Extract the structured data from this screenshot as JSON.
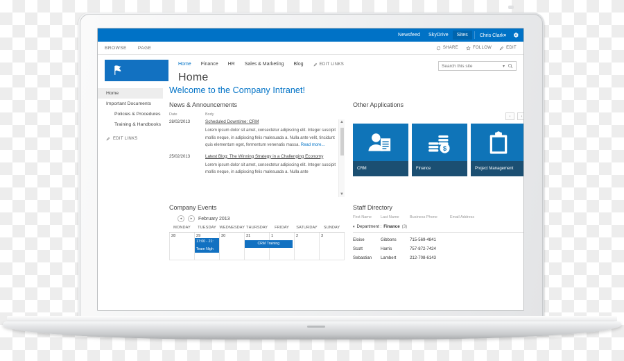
{
  "suite_bar": {
    "links": [
      "Newsfeed",
      "SkyDrive",
      "Sites"
    ],
    "active_link": "Sites",
    "user": "Chris Clark",
    "user_caret": "▾",
    "settings_icon": "gear-icon"
  },
  "ribbon": {
    "tabs": [
      "BROWSE",
      "PAGE"
    ],
    "actions": [
      {
        "label": "SHARE",
        "icon": "share-icon"
      },
      {
        "label": "FOLLOW",
        "icon": "star-icon"
      },
      {
        "label": "EDIT",
        "icon": "pencil-icon"
      }
    ]
  },
  "site": {
    "logo_icon": "flag-icon",
    "nav": [
      "Home",
      "Finance",
      "HR",
      "Sales & Marketing",
      "Blog"
    ],
    "nav_selected": "Home",
    "edit_links": "EDIT LINKS",
    "page_title": "Home"
  },
  "search": {
    "placeholder": "Search this site",
    "caret": "▾",
    "icon": "search-icon"
  },
  "quick_launch": {
    "items": [
      {
        "label": "Home",
        "sub": false,
        "selected": true
      },
      {
        "label": "Important Documents",
        "sub": false,
        "selected": false
      },
      {
        "label": "Policies & Procedures",
        "sub": true,
        "selected": false
      },
      {
        "label": "Training & Handbooks",
        "sub": true,
        "selected": false
      }
    ],
    "edit_links": "EDIT LINKS"
  },
  "content": {
    "welcome": "Welcome to the Company Intranet!",
    "news": {
      "title": "News & Announcements",
      "col_date": "Date",
      "col_body": "Body",
      "read_more": "Read more...",
      "items": [
        {
          "date": "28/02/2013",
          "link": "Scheduled Downtime: CRM",
          "body": "Lorem ipsum dolor sit amet, consectetur adipiscing elit. Integer suscipit mollis neque, in adipiscing felis malesuada a. Nulla ante velit, tincidunt quis elementum eget, fermentum venenatis massa."
        },
        {
          "date": "25/02/2013",
          "link": "Latest Blog: The Winning Strategy in a Challenging Economy",
          "body": "Lorem ipsum dolor sit amet, consectetur adipiscing elit. Integer suscipit mollis neque, in adipiscing felis malesuada a. Nulla ante"
        }
      ]
    },
    "apps": {
      "title": "Other Applications",
      "prev": "‹",
      "next": "›",
      "tiles": [
        {
          "label": "CRM",
          "icon": "person-document-icon"
        },
        {
          "label": "Finance",
          "icon": "coins-dollar-icon"
        },
        {
          "label": "Project Management",
          "icon": "clipboard-icon"
        }
      ]
    },
    "events": {
      "title": "Company Events",
      "prev": "◂",
      "next": "▸",
      "month": "February 2013",
      "day_headers": [
        "MONDAY",
        "TUESDAY",
        "WEDNESDAY",
        "THURSDAY",
        "FRIDAY",
        "SATURDAY",
        "SUNDAY"
      ],
      "dates": [
        "28",
        "29",
        "30",
        "31",
        "1",
        "2",
        "3"
      ],
      "event_tuesday_time": "17:00 - 21:",
      "event_tuesday_title": "Team Nigh",
      "event_thursday_title": "CRM Training"
    },
    "staff": {
      "title": "Staff Directory",
      "columns": [
        "First Name",
        "Last Name",
        "Business Phone",
        "Email Address"
      ],
      "group_triangle": "▾",
      "group_label": "Department :",
      "group_value": "Finance",
      "group_count": "(3)",
      "rows": [
        {
          "first": "Eloise",
          "last": "Gibbons",
          "phone": "715-569-4841"
        },
        {
          "first": "Scott",
          "last": "Harris",
          "phone": "757-872-7424"
        },
        {
          "first": "Sebastian",
          "last": "Lambert",
          "phone": "212-708-6143"
        }
      ]
    }
  },
  "colors": {
    "suite_bar": "#0072c6",
    "accent": "#0072c6",
    "tile": "#0f74b8",
    "tile_caption": "#1b4f72",
    "logo": "#1271c1"
  }
}
